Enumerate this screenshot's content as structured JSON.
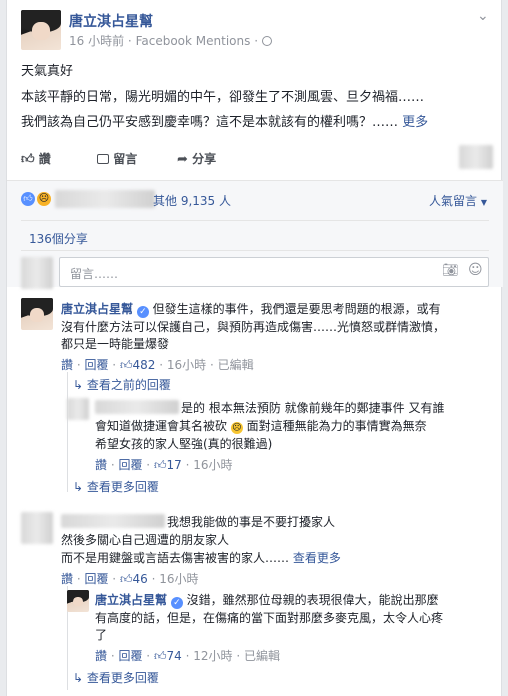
{
  "post": {
    "author": "唐立淇占星幫",
    "time": "16 小時前",
    "source": "Facebook Mentions",
    "dot": "·",
    "globe_icon": "globe-icon",
    "line1": "天氣真好",
    "line2": "本該平靜的日常，陽光明媚的中午，卻發生了不測風雲、旦夕禍福……",
    "line3": "我們該為自己仍平安感到慶幸嗎？這不是本就該有的權利嗎？……",
    "more": "更多"
  },
  "actions": {
    "like": "讚",
    "comment": "留言",
    "share": "分享"
  },
  "reactions": {
    "count_text": "其他 9,135 人",
    "sort": "人氣留言",
    "shares": "136個分享"
  },
  "composer": {
    "placeholder": "留言……"
  },
  "comments": [
    {
      "author": "唐立淇占星幫",
      "text1": "但發生這樣的事件，我們還是要思考問題的根源，或有",
      "text2": "沒有什麼方法可以保護自己，與預防再造成傷害……光憤怒或群情激憤，",
      "text3": "都只是一時能量爆發",
      "like": "讚",
      "reply": "回覆",
      "likes": "482",
      "time": "16小時",
      "edited": "已編輯",
      "prev_replies": "查看之前的回覆"
    },
    {
      "text1": "是的 根本無法預防 就像前幾年的鄭捷事件 又有誰",
      "text2": "會知道做捷運會其名被砍",
      "text2b": "面對這種無能為力的事情實為無奈",
      "text3": "希望女孩的家人堅強(真的很難過)",
      "like": "讚",
      "reply": "回覆",
      "likes": "17",
      "time": "16小時",
      "more_replies": "查看更多回覆"
    },
    {
      "text1": "我想我能做的事是不要打擾家人",
      "text2": "然後多關心自己週遭的朋友家人",
      "text3": "而不是用鍵盤或言語去傷害被害的家人……",
      "more": "查看更多",
      "like": "讚",
      "reply": "回覆",
      "likes": "46",
      "time": "16小時"
    },
    {
      "author": "唐立淇占星幫",
      "text1": "沒錯，雖然那位母親的表現很偉大，能說出那麼",
      "text2": "有高度的話，但是，在傷痛的當下面對那麼多麥克風，太令人心疼",
      "text3": "了",
      "like": "讚",
      "reply": "回覆",
      "likes": "74",
      "time": "12小時",
      "edited": "已編輯",
      "more_replies": "查看更多回覆"
    }
  ],
  "colors": {
    "link": "#365899",
    "muted": "#90949c",
    "like_blue": "#5890ff"
  }
}
